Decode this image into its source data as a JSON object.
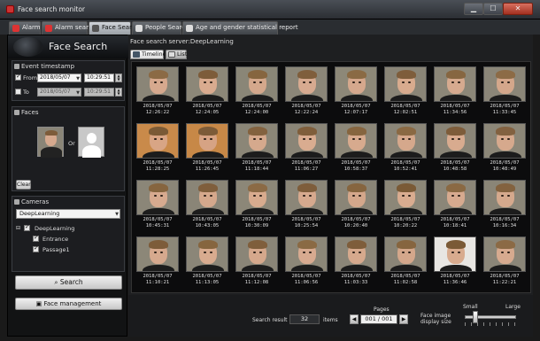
{
  "window": {
    "title": "Face search monitor",
    "min_glyph": "▁",
    "max_glyph": "☐",
    "close_glyph": "✕"
  },
  "tabs": [
    {
      "label": "Alarm",
      "active": false,
      "icon": "alarm-icon",
      "color": "#d33"
    },
    {
      "label": "Alarm search",
      "active": false,
      "icon": "alarm-search-icon",
      "color": "#d33"
    },
    {
      "label": "Face Search",
      "active": true,
      "icon": "face-search-icon",
      "color": "#555"
    },
    {
      "label": "People Search",
      "active": false,
      "icon": "people-search-icon",
      "color": "#ddd"
    },
    {
      "label": "Age and gender statistical report",
      "active": false,
      "icon": "bar-chart-icon",
      "color": "#ddd"
    }
  ],
  "left": {
    "header_title": "Face Search",
    "event": {
      "title": "Event timestamp",
      "from_label": "From",
      "to_label": "To",
      "from_checked": true,
      "to_checked": false,
      "from_date": "2018/05/07",
      "from_time": "10:29:51",
      "to_date": "2018/05/07",
      "to_time": "10:29:51"
    },
    "faces": {
      "title": "Faces",
      "or_label": "Or",
      "clear_label": "Clear"
    },
    "cameras": {
      "title": "Cameras",
      "selected": "DeepLearning",
      "tree": [
        {
          "label": "DeepLearning",
          "checked": true,
          "level": 0
        },
        {
          "label": "Entrance",
          "checked": true,
          "level": 1
        },
        {
          "label": "Passage1",
          "checked": true,
          "level": 1
        }
      ]
    },
    "search_label": "Search",
    "face_management_label": "Face management"
  },
  "right": {
    "server_label": "Face search server:DeepLearning",
    "view_tabs": [
      {
        "label": "Timeline",
        "active": true
      },
      {
        "label": "List",
        "active": false
      }
    ],
    "results": [
      {
        "date": "2018/05/07",
        "time": "12:26:22",
        "bg": "#8a8577",
        "skin": "#d6a98e",
        "hair": "#8b6a45"
      },
      {
        "date": "2018/05/07",
        "time": "12:24:05",
        "bg": "#8c8778",
        "skin": "#d9ab8f",
        "hair": "#7d5c3a"
      },
      {
        "date": "2018/05/07",
        "time": "12:24:00",
        "bg": "#8a8677",
        "skin": "#d4a88c",
        "hair": "#86653f"
      },
      {
        "date": "2018/05/07",
        "time": "12:22:24",
        "bg": "#8b8678",
        "skin": "#d7aa90",
        "hair": "#7f5e3c"
      },
      {
        "date": "2018/05/07",
        "time": "12:07:17",
        "bg": "#8d8878",
        "skin": "#d5a88d",
        "hair": "#8a6a44"
      },
      {
        "date": "2018/05/07",
        "time": "12:02:51",
        "bg": "#8a8577",
        "skin": "#d8ab8e",
        "hair": "#7e5d3b"
      },
      {
        "date": "2018/05/07",
        "time": "11:34:56",
        "bg": "#8c8778",
        "skin": "#d6aa8f",
        "hair": "#866641"
      },
      {
        "date": "2018/05/07",
        "time": "11:33:45",
        "bg": "#8b8678",
        "skin": "#d4a78b",
        "hair": "#8c6b46"
      },
      {
        "date": "2018/05/07",
        "time": "11:28:25",
        "bg": "#c98a4a",
        "skin": "#d8a585",
        "hair": "#7a5a36"
      },
      {
        "date": "2018/05/07",
        "time": "11:26:45",
        "bg": "#c78847",
        "skin": "#d6a384",
        "hair": "#7c5b38"
      },
      {
        "date": "2018/05/07",
        "time": "11:18:44",
        "bg": "#8b8677",
        "skin": "#d5a98d",
        "hair": "#83623f"
      },
      {
        "date": "2018/05/07",
        "time": "11:06:27",
        "bg": "#8a8577",
        "skin": "#d9ac90",
        "hair": "#7f5e3b"
      },
      {
        "date": "2018/05/07",
        "time": "10:58:37",
        "bg": "#8c8778",
        "skin": "#d7aa8e",
        "hair": "#86653f"
      },
      {
        "date": "2018/05/07",
        "time": "10:52:41",
        "bg": "#8b8678",
        "skin": "#d5a88c",
        "hair": "#8a6943"
      },
      {
        "date": "2018/05/07",
        "time": "10:48:58",
        "bg": "#8a8577",
        "skin": "#d8ab8f",
        "hair": "#7d5c3a"
      },
      {
        "date": "2018/05/07",
        "time": "10:48:49",
        "bg": "#8c8778",
        "skin": "#d6a98d",
        "hair": "#826140"
      },
      {
        "date": "2018/05/07",
        "time": "10:45:31",
        "bg": "#8b8678",
        "skin": "#d7aa8f",
        "hair": "#86653f"
      },
      {
        "date": "2018/05/07",
        "time": "10:43:05",
        "bg": "#8a8577",
        "skin": "#d5a88c",
        "hair": "#7f5e3c"
      },
      {
        "date": "2018/05/07",
        "time": "10:30:09",
        "bg": "#8c8778",
        "skin": "#d8ab8e",
        "hair": "#8b6a45"
      },
      {
        "date": "2018/05/07",
        "time": "10:25:54",
        "bg": "#8b8678",
        "skin": "#d6a98e",
        "hair": "#7e5d3b"
      },
      {
        "date": "2018/05/07",
        "time": "10:20:40",
        "bg": "#8a8577",
        "skin": "#d4a78b",
        "hair": "#86653f"
      },
      {
        "date": "2018/05/07",
        "time": "10:20:22",
        "bg": "#8c8778",
        "skin": "#d9ac90",
        "hair": "#7a5a36"
      },
      {
        "date": "2018/05/07",
        "time": "10:18:41",
        "bg": "#8b8678",
        "skin": "#d7aa8f",
        "hair": "#8a6943"
      },
      {
        "date": "2018/05/07",
        "time": "10:16:34",
        "bg": "#8a8577",
        "skin": "#d5a98d",
        "hair": "#83623f"
      },
      {
        "date": "2018/05/07",
        "time": "11:10:21",
        "bg": "#8c8778",
        "skin": "#d6a98e",
        "hair": "#7d5c3a"
      },
      {
        "date": "2018/05/07",
        "time": "11:13:05",
        "bg": "#8b8678",
        "skin": "#d8ab8f",
        "hair": "#86653f"
      },
      {
        "date": "2018/05/07",
        "time": "11:12:08",
        "bg": "#8a8577",
        "skin": "#d5a88c",
        "hair": "#7f5e3c"
      },
      {
        "date": "2018/05/07",
        "time": "11:06:56",
        "bg": "#8c8778",
        "skin": "#d7aa90",
        "hair": "#8a6a44"
      },
      {
        "date": "2018/05/07",
        "time": "11:03:33",
        "bg": "#8b8678",
        "skin": "#d6a98d",
        "hair": "#7e5d3b"
      },
      {
        "date": "2018/05/07",
        "time": "11:02:58",
        "bg": "#8a8577",
        "skin": "#d4a78b",
        "hair": "#86653f"
      },
      {
        "date": "2018/05/07",
        "time": "11:36:46",
        "bg": "#e8e6e2",
        "skin": "#d8ab8e",
        "hair": "#7a5a36"
      },
      {
        "date": "2018/05/07",
        "time": "11:22:21",
        "bg": "#8b8678",
        "skin": "#d6aa8f",
        "hair": "#8b6a45"
      }
    ],
    "footer": {
      "search_result_label": "Search result",
      "count": "32",
      "items_label": "items",
      "pages_label": "Pages",
      "page_value": "001 / 001",
      "prev_glyph": "◀",
      "next_glyph": "▶",
      "size_label": "Face image display size",
      "small_label": "Small",
      "large_label": "Large",
      "size_level": 0.15
    }
  }
}
